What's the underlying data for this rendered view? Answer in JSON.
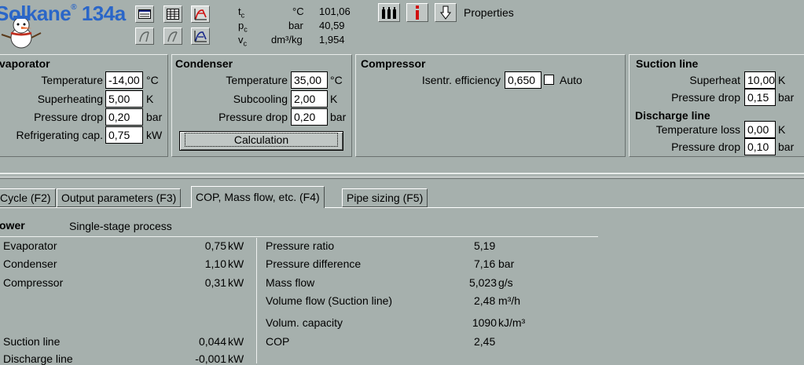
{
  "app": {
    "title": "Solkane",
    "title_sup": "®",
    "refrigerant": "134a",
    "properties_label": "Properties"
  },
  "critical": [
    {
      "symbol": "t",
      "sub": "c",
      "unit": "°C",
      "value": "101,06"
    },
    {
      "symbol": "p",
      "sub": "c",
      "unit": "bar",
      "value": "40,59"
    },
    {
      "symbol": "v",
      "sub": "c",
      "unit": "dm³/kg",
      "value": "1,954"
    }
  ],
  "evaporator": {
    "title": "vaporator",
    "rows": [
      {
        "label": "Temperature",
        "value": "-14,00",
        "unit": "°C"
      },
      {
        "label": "Superheating",
        "value": "5,00",
        "unit": "K"
      },
      {
        "label": "Pressure drop",
        "value": "0,20",
        "unit": "bar"
      },
      {
        "label": "Refrigerating cap.",
        "value": "0,75",
        "unit": "kW"
      }
    ]
  },
  "condenser": {
    "title": "Condenser",
    "rows": [
      {
        "label": "Temperature",
        "value": "35,00",
        "unit": "°C"
      },
      {
        "label": "Subcooling",
        "value": "2,00",
        "unit": "K"
      },
      {
        "label": "Pressure drop",
        "value": "0,20",
        "unit": "bar"
      }
    ],
    "calc_label": "Calculation"
  },
  "compressor": {
    "title": "Compressor",
    "label": "Isentr. efficiency",
    "value": "0,650",
    "auto_label": "Auto"
  },
  "suction": {
    "title": "Suction line",
    "rows": [
      {
        "label": "Superheat",
        "value": "10,00",
        "unit": "K"
      },
      {
        "label": "Pressure drop",
        "value": "0,15",
        "unit": "bar"
      }
    ]
  },
  "discharge": {
    "title": "Discharge line",
    "rows": [
      {
        "label": "Temperature loss",
        "value": "0,00",
        "unit": "K"
      },
      {
        "label": "Pressure drop",
        "value": "0,10",
        "unit": "bar"
      }
    ]
  },
  "tabs": [
    {
      "label": "Cycle (F2)"
    },
    {
      "label": "Output parameters (F3)"
    },
    {
      "label": "COP, Mass flow, etc. (F4)"
    },
    {
      "label": "Pipe sizing (F5)"
    }
  ],
  "results": {
    "power_title": "ower",
    "process": "Single-stage process",
    "left": [
      {
        "label": "Evaporator",
        "value": "0,75",
        "unit": "kW"
      },
      {
        "label": "Condenser",
        "value": "1,10",
        "unit": "kW"
      },
      {
        "label": "Compressor",
        "value": "0,31",
        "unit": "kW"
      },
      {
        "label": "Suction line",
        "value": "0,044",
        "unit": "kW"
      },
      {
        "label": "Discharge line",
        "value": "-0,001",
        "unit": "kW"
      }
    ],
    "right": [
      {
        "label": "Pressure ratio",
        "value": "5,19",
        "unit": ""
      },
      {
        "label": "Pressure difference",
        "value": "7,16",
        "unit": "bar"
      },
      {
        "label": "Mass flow",
        "value": "5,023",
        "unit": "g/s"
      },
      {
        "label": "Volume flow (Suction line)",
        "value": "2,48",
        "unit": "m³/h"
      },
      {
        "label": "Volum. capacity",
        "value": "1090",
        "unit": "kJ/m³"
      },
      {
        "label": "COP",
        "value": "2,45",
        "unit": ""
      }
    ]
  }
}
